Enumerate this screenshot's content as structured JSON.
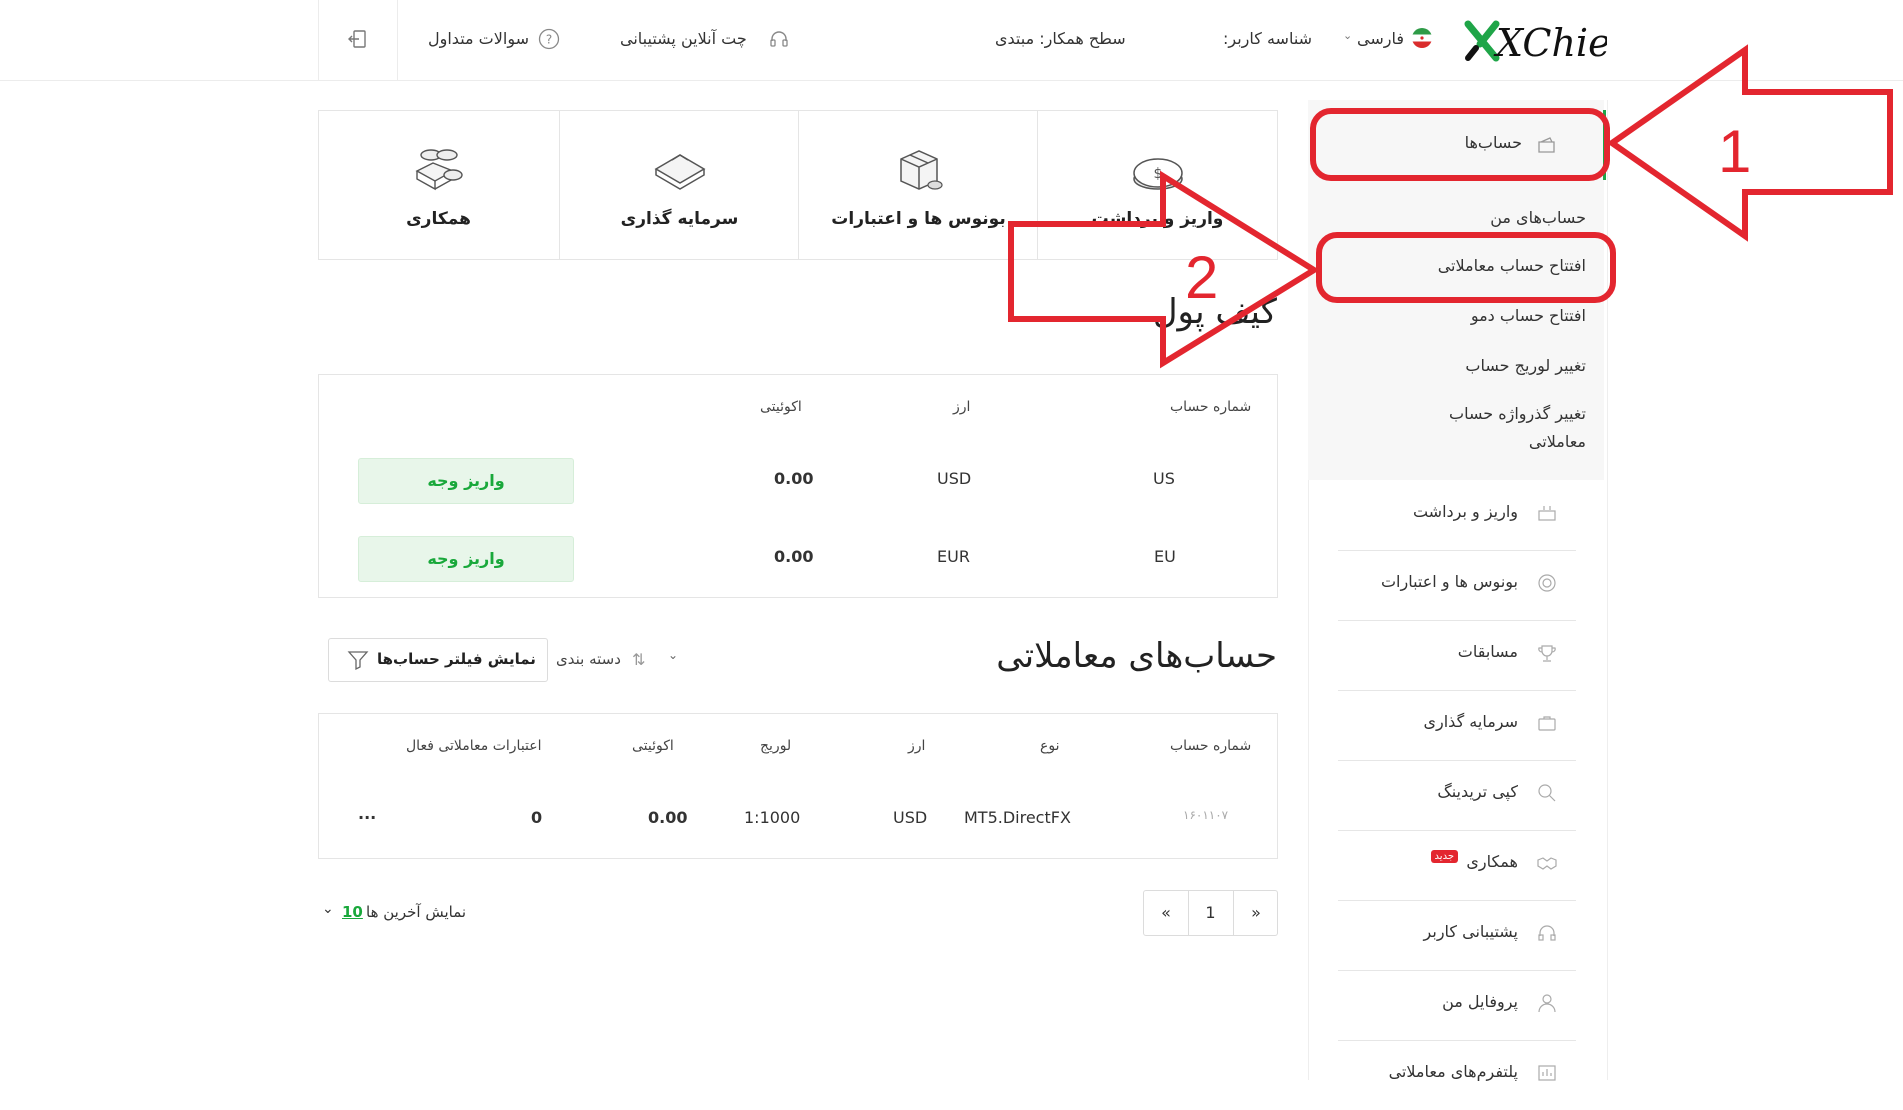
{
  "header": {
    "logo_text": "XChief",
    "language": "فارسی",
    "user_id_label": "شناسه کاربر:",
    "partner_level": "سطح همکار: مبتدی",
    "live_chat": "چت آنلاین پشتیبانی",
    "faq": "سوالات متداول"
  },
  "sidebar": {
    "accounts": "حساب‌ها",
    "submenu": [
      "حساب‌های من",
      "افتتاح حساب معاملاتی",
      "افتتاح حساب دمو",
      "تغییر لوریج حساب",
      "تغییر گذرواژه حساب",
      "معاملاتی"
    ],
    "items": [
      "واریز و برداشت",
      "بونوس ها و اعتبارات",
      "مسابقات",
      "سرمایه گذاری",
      "کپی تریدینگ",
      "همکاری",
      "پشتیبانی کاربر",
      "پروفایل من",
      "پلتفرم‌های معاملاتی"
    ],
    "new_badge": "جدید"
  },
  "tiles": [
    "واریز و برداشت",
    "بونوس ها و اعتبارات",
    "سرمایه گذاری",
    "همکاری"
  ],
  "wallet": {
    "title": "کیف پول",
    "headers": {
      "account": "شماره حساب",
      "currency": "ارز",
      "equity": "اکوئیتی"
    },
    "rows": [
      {
        "account": "US",
        "currency": "USD",
        "equity": "0.00",
        "action": "واریز وجه"
      },
      {
        "account": "EU",
        "currency": "EUR",
        "equity": "0.00",
        "action": "واریز وجه"
      }
    ]
  },
  "trading": {
    "title": "حساب‌های معاملاتی",
    "sort_label": "دسته بندی",
    "filter_label": "نمایش فیلتر حساب‌ها",
    "headers": {
      "account": "شماره حساب",
      "type": "نوع",
      "currency": "ارز",
      "leverage": "لوریج",
      "equity": "اکوئیتی",
      "credits": "اعتبارات معاملاتی فعال"
    },
    "rows": [
      {
        "account": "۱۶۰۱۱۰۷",
        "type": "MT5.DirectFX",
        "currency": "USD",
        "leverage": "1:1000",
        "equity": "0.00",
        "credits": "0",
        "more": "..."
      }
    ],
    "show_last_label": "نمایش آخرین ها",
    "show_last_count": "10",
    "pager": {
      "prev": "«",
      "page": "1",
      "next": "»"
    }
  },
  "annotations": {
    "one": "1",
    "two": "2"
  },
  "colors": {
    "accent_green": "#19a83b",
    "annotation_red": "#e3262f"
  }
}
